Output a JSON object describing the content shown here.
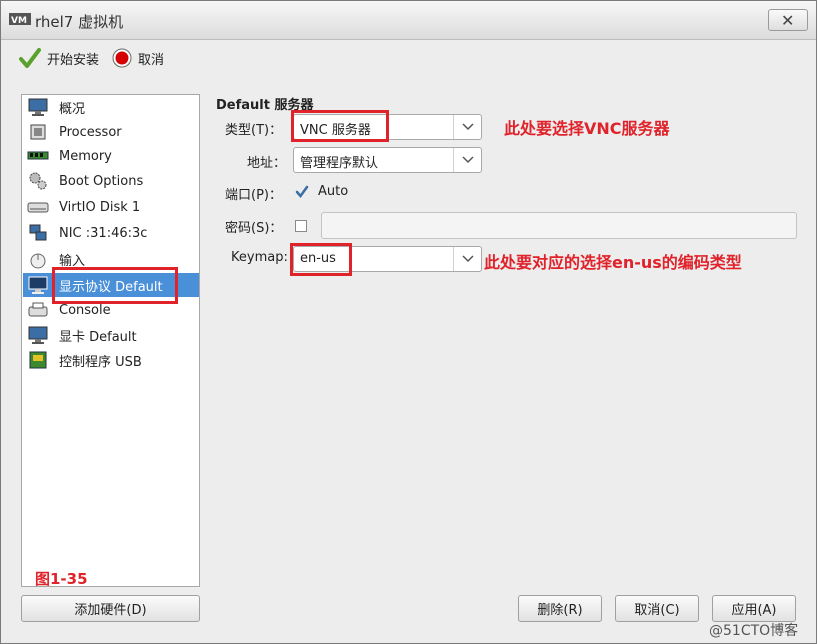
{
  "window": {
    "title": "rhel7 虚拟机",
    "close_glyph": "✕"
  },
  "toolbar": {
    "begin_install": "开始安装",
    "cancel": "取消"
  },
  "sidebar": {
    "items": [
      {
        "label": "概况",
        "icon": "monitor-icon"
      },
      {
        "label": "Processor",
        "icon": "cpu-icon"
      },
      {
        "label": "Memory",
        "icon": "memory-icon"
      },
      {
        "label": "Boot Options",
        "icon": "gears-icon"
      },
      {
        "label": "VirtIO Disk 1",
        "icon": "disk-icon"
      },
      {
        "label": "NIC :31:46:3c",
        "icon": "network-icon"
      },
      {
        "label": "输入",
        "icon": "mouse-icon"
      },
      {
        "label": "显示协议 Default",
        "icon": "display-icon",
        "selected": true
      },
      {
        "label": "Console",
        "icon": "console-icon"
      },
      {
        "label": "显卡 Default",
        "icon": "video-card-icon"
      },
      {
        "label": "控制程序 USB",
        "icon": "controller-icon"
      }
    ],
    "add_hardware": "添加硬件(D)"
  },
  "figure_label": "图1-35",
  "panel": {
    "section_title": "Default 服务器",
    "type_label": "类型(T)：",
    "type_value": "VNC 服务器",
    "address_label": "地址：",
    "address_value": "管理程序默认",
    "port_label": "端口(P)：",
    "port_auto": "Auto",
    "password_label": "密码(S)：",
    "keymap_label": "Keymap:",
    "keymap_value": "en-us"
  },
  "annotations": {
    "vnc_note": "此处要选择VNC服务器",
    "keymap_note": "此处要对应的选择en-us的编码类型"
  },
  "buttons": {
    "remove": "删除(R)",
    "cancel": "取消(C)",
    "apply": "应用(A)"
  },
  "watermark": "@51CTO博客",
  "colors": {
    "annotation_red": "#e0222a",
    "selection_blue": "#4a90d9"
  }
}
